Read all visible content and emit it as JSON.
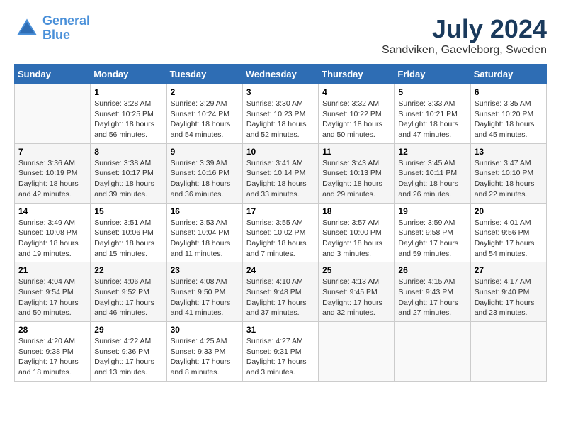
{
  "header": {
    "logo_line1": "General",
    "logo_line2": "Blue",
    "month": "July 2024",
    "location": "Sandviken, Gaevleborg, Sweden"
  },
  "days_of_week": [
    "Sunday",
    "Monday",
    "Tuesday",
    "Wednesday",
    "Thursday",
    "Friday",
    "Saturday"
  ],
  "weeks": [
    [
      {
        "day": "",
        "info": ""
      },
      {
        "day": "1",
        "info": "Sunrise: 3:28 AM\nSunset: 10:25 PM\nDaylight: 18 hours\nand 56 minutes."
      },
      {
        "day": "2",
        "info": "Sunrise: 3:29 AM\nSunset: 10:24 PM\nDaylight: 18 hours\nand 54 minutes."
      },
      {
        "day": "3",
        "info": "Sunrise: 3:30 AM\nSunset: 10:23 PM\nDaylight: 18 hours\nand 52 minutes."
      },
      {
        "day": "4",
        "info": "Sunrise: 3:32 AM\nSunset: 10:22 PM\nDaylight: 18 hours\nand 50 minutes."
      },
      {
        "day": "5",
        "info": "Sunrise: 3:33 AM\nSunset: 10:21 PM\nDaylight: 18 hours\nand 47 minutes."
      },
      {
        "day": "6",
        "info": "Sunrise: 3:35 AM\nSunset: 10:20 PM\nDaylight: 18 hours\nand 45 minutes."
      }
    ],
    [
      {
        "day": "7",
        "info": "Sunrise: 3:36 AM\nSunset: 10:19 PM\nDaylight: 18 hours\nand 42 minutes."
      },
      {
        "day": "8",
        "info": "Sunrise: 3:38 AM\nSunset: 10:17 PM\nDaylight: 18 hours\nand 39 minutes."
      },
      {
        "day": "9",
        "info": "Sunrise: 3:39 AM\nSunset: 10:16 PM\nDaylight: 18 hours\nand 36 minutes."
      },
      {
        "day": "10",
        "info": "Sunrise: 3:41 AM\nSunset: 10:14 PM\nDaylight: 18 hours\nand 33 minutes."
      },
      {
        "day": "11",
        "info": "Sunrise: 3:43 AM\nSunset: 10:13 PM\nDaylight: 18 hours\nand 29 minutes."
      },
      {
        "day": "12",
        "info": "Sunrise: 3:45 AM\nSunset: 10:11 PM\nDaylight: 18 hours\nand 26 minutes."
      },
      {
        "day": "13",
        "info": "Sunrise: 3:47 AM\nSunset: 10:10 PM\nDaylight: 18 hours\nand 22 minutes."
      }
    ],
    [
      {
        "day": "14",
        "info": "Sunrise: 3:49 AM\nSunset: 10:08 PM\nDaylight: 18 hours\nand 19 minutes."
      },
      {
        "day": "15",
        "info": "Sunrise: 3:51 AM\nSunset: 10:06 PM\nDaylight: 18 hours\nand 15 minutes."
      },
      {
        "day": "16",
        "info": "Sunrise: 3:53 AM\nSunset: 10:04 PM\nDaylight: 18 hours\nand 11 minutes."
      },
      {
        "day": "17",
        "info": "Sunrise: 3:55 AM\nSunset: 10:02 PM\nDaylight: 18 hours\nand 7 minutes."
      },
      {
        "day": "18",
        "info": "Sunrise: 3:57 AM\nSunset: 10:00 PM\nDaylight: 18 hours\nand 3 minutes."
      },
      {
        "day": "19",
        "info": "Sunrise: 3:59 AM\nSunset: 9:58 PM\nDaylight: 17 hours\nand 59 minutes."
      },
      {
        "day": "20",
        "info": "Sunrise: 4:01 AM\nSunset: 9:56 PM\nDaylight: 17 hours\nand 54 minutes."
      }
    ],
    [
      {
        "day": "21",
        "info": "Sunrise: 4:04 AM\nSunset: 9:54 PM\nDaylight: 17 hours\nand 50 minutes."
      },
      {
        "day": "22",
        "info": "Sunrise: 4:06 AM\nSunset: 9:52 PM\nDaylight: 17 hours\nand 46 minutes."
      },
      {
        "day": "23",
        "info": "Sunrise: 4:08 AM\nSunset: 9:50 PM\nDaylight: 17 hours\nand 41 minutes."
      },
      {
        "day": "24",
        "info": "Sunrise: 4:10 AM\nSunset: 9:48 PM\nDaylight: 17 hours\nand 37 minutes."
      },
      {
        "day": "25",
        "info": "Sunrise: 4:13 AM\nSunset: 9:45 PM\nDaylight: 17 hours\nand 32 minutes."
      },
      {
        "day": "26",
        "info": "Sunrise: 4:15 AM\nSunset: 9:43 PM\nDaylight: 17 hours\nand 27 minutes."
      },
      {
        "day": "27",
        "info": "Sunrise: 4:17 AM\nSunset: 9:40 PM\nDaylight: 17 hours\nand 23 minutes."
      }
    ],
    [
      {
        "day": "28",
        "info": "Sunrise: 4:20 AM\nSunset: 9:38 PM\nDaylight: 17 hours\nand 18 minutes."
      },
      {
        "day": "29",
        "info": "Sunrise: 4:22 AM\nSunset: 9:36 PM\nDaylight: 17 hours\nand 13 minutes."
      },
      {
        "day": "30",
        "info": "Sunrise: 4:25 AM\nSunset: 9:33 PM\nDaylight: 17 hours\nand 8 minutes."
      },
      {
        "day": "31",
        "info": "Sunrise: 4:27 AM\nSunset: 9:31 PM\nDaylight: 17 hours\nand 3 minutes."
      },
      {
        "day": "",
        "info": ""
      },
      {
        "day": "",
        "info": ""
      },
      {
        "day": "",
        "info": ""
      }
    ]
  ]
}
